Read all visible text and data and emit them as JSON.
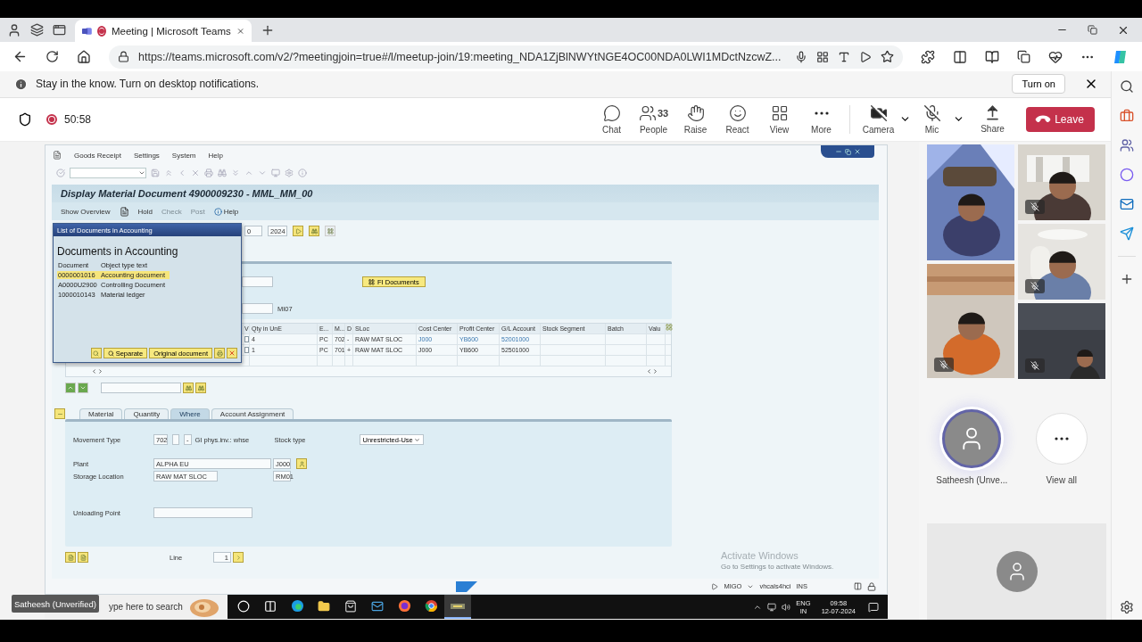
{
  "browser": {
    "tab": {
      "title": "Meeting | Microsoft Teams",
      "recording": true
    },
    "url": "https://teams.microsoft.com/v2/?meetingjoin=true#/l/meetup-join/19:meeting_NDA1ZjBlNWYtNGE4OC00NDA0LWI1MDctNzcwZ..."
  },
  "notification": {
    "text": "Stay in the know. Turn on desktop notifications.",
    "button": "Turn on"
  },
  "meeting": {
    "recording": true,
    "timer": "50:58",
    "controls": [
      {
        "kind": "chat",
        "label": "Chat"
      },
      {
        "kind": "people",
        "label": "People",
        "count": "33"
      },
      {
        "kind": "raise",
        "label": "Raise"
      },
      {
        "kind": "react",
        "label": "React"
      },
      {
        "kind": "view",
        "label": "View"
      },
      {
        "kind": "more",
        "label": "More"
      }
    ],
    "devices": [
      {
        "kind": "camera",
        "label": "Camera",
        "off": true
      },
      {
        "kind": "mic",
        "label": "Mic",
        "off": true
      }
    ],
    "share": "Share",
    "leave": "Leave"
  },
  "sap": {
    "menu": [
      "Goods Receipt",
      "Settings",
      "System",
      "Help"
    ],
    "title": "Display Material Document 4900009230 - MML_MM_00",
    "app_toolbar": [
      {
        "kind": "button",
        "label": "Show Overview",
        "disabled": false
      },
      {
        "kind": "page"
      },
      {
        "kind": "button",
        "label": "Hold",
        "disabled": false
      },
      {
        "kind": "button",
        "label": "Check",
        "disabled": true
      },
      {
        "kind": "button",
        "label": "Post",
        "disabled": true
      },
      {
        "kind": "help",
        "label": "Help",
        "disabled": false
      }
    ],
    "header_row": {
      "field_1": "0",
      "year": "2024"
    },
    "fi_documents": "FI Documents",
    "header_field": "MI07",
    "items": {
      "columns": [
        "V",
        "Qty in UnE",
        "E...",
        "M...",
        "D",
        "SLoc",
        "Cost Center",
        "Profit Center",
        "G/L Account",
        "Stock Segment",
        "Batch",
        "Valu"
      ],
      "rows": [
        {
          "checked": false,
          "qty": "4",
          "unit": "PC",
          "mvt": "702",
          "sign": "-",
          "sloc": "RAW MAT SLOC",
          "cost_center": "J000",
          "profit_center": "YB600",
          "gl_account": "52001000"
        },
        {
          "checked": false,
          "qty": "1",
          "unit": "PC",
          "mvt": "701",
          "sign": "+",
          "sloc": "RAW MAT SLOC",
          "cost_center": "J000",
          "profit_center": "YB600",
          "gl_account": "52501000"
        }
      ]
    },
    "tabs": [
      {
        "label": "Material",
        "selected": false
      },
      {
        "label": "Quantity",
        "selected": false
      },
      {
        "label": "Where",
        "selected": true
      },
      {
        "label": "Account Assignment",
        "selected": false
      }
    ],
    "where": {
      "movement_type_label": "Movement Type",
      "movement_type": "702",
      "movement_sign": "-",
      "movement_text": "GI phys.inv.: whse",
      "stock_type_label": "Stock type",
      "stock_type": "Unrestricted-Use",
      "plant_label": "Plant",
      "plant": "ALPHA EU",
      "plant_code": "J000",
      "sloc_label": "Storage Location",
      "sloc": "RAW MAT SLOC",
      "sloc_code": "RM01",
      "unloading_label": "Unloading Point"
    },
    "line_label": "Line",
    "line": "1",
    "status": {
      "transaction": "MIGO",
      "server": "vhcals4hci",
      "mode": "INS"
    },
    "popup": {
      "title": "List of Documents in Accounting",
      "heading": "Documents in Accounting",
      "columns": [
        "Document",
        "Object type text"
      ],
      "rows": [
        {
          "document": "0000001016",
          "type": "Accounting document",
          "selected": true
        },
        {
          "document": "A0000U2900",
          "type": "Controlling Document",
          "selected": false
        },
        {
          "document": "1000010143",
          "type": "Material ledger",
          "selected": false
        }
      ],
      "buttons": [
        "Separate",
        "Original document"
      ]
    }
  },
  "activation": {
    "title": "Activate Windows",
    "text": "Go to Settings to activate Windows."
  },
  "taskbar": {
    "search": "ype here to search",
    "apps": [
      {
        "kind": "cortana",
        "selected": false
      },
      {
        "kind": "taskview",
        "selected": false
      },
      {
        "kind": "edge",
        "selected": false
      },
      {
        "kind": "explorer",
        "selected": false
      },
      {
        "kind": "store",
        "selected": false
      },
      {
        "kind": "mail",
        "selected": false
      },
      {
        "kind": "firefox",
        "selected": false
      },
      {
        "kind": "chrome",
        "selected": false
      },
      {
        "kind": "sap",
        "selected": true
      }
    ],
    "lang": "ENG",
    "region": "IN",
    "time": "09:58",
    "date": "12-07-2024"
  },
  "presenter_label": "Satheesh (Unverified)",
  "video_tiles": {
    "left": [
      {
        "muted": false
      },
      {
        "muted": true
      }
    ],
    "right": [
      {
        "muted": true
      },
      {
        "muted": true
      },
      {
        "muted": true
      }
    ]
  },
  "speaker": {
    "name": "Satheesh (Unve...",
    "speaking": true
  },
  "view_all": "View all"
}
